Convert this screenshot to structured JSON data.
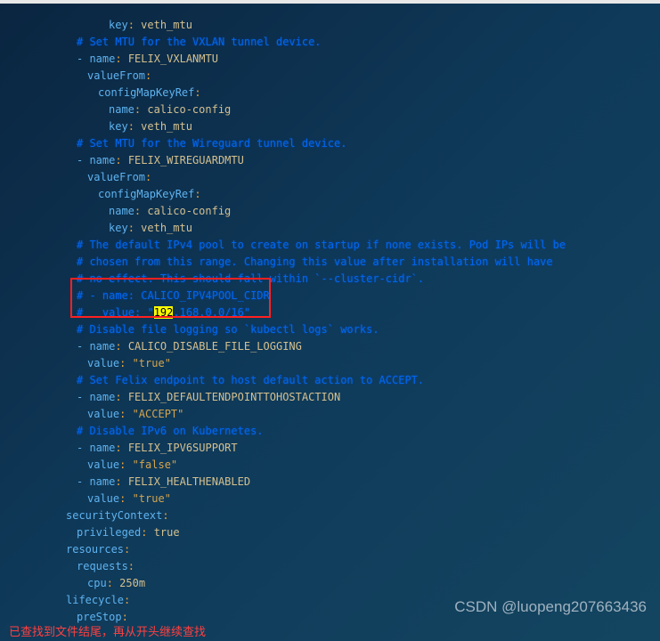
{
  "code": {
    "lines": [
      {
        "indent": "indent-4",
        "parts": [
          {
            "t": "key",
            "v": "key"
          },
          {
            "t": "colon",
            "v": ": "
          },
          {
            "t": "value-plain",
            "v": "veth_mtu"
          }
        ]
      },
      {
        "indent": "indent-1",
        "parts": [
          {
            "t": "comment",
            "v": "# Set MTU for the VXLAN tunnel device."
          }
        ]
      },
      {
        "indent": "indent-1",
        "parts": [
          {
            "t": "dash",
            "v": "- "
          },
          {
            "t": "key",
            "v": "name"
          },
          {
            "t": "colon",
            "v": ": "
          },
          {
            "t": "value-plain",
            "v": "FELIX_VXLANMTU"
          }
        ]
      },
      {
        "indent": "indent-2",
        "parts": [
          {
            "t": "key",
            "v": "valueFrom"
          },
          {
            "t": "colon",
            "v": ":"
          }
        ]
      },
      {
        "indent": "indent-3",
        "parts": [
          {
            "t": "key",
            "v": "configMapKeyRef"
          },
          {
            "t": "colon",
            "v": ":"
          }
        ]
      },
      {
        "indent": "indent-4",
        "parts": [
          {
            "t": "key",
            "v": "name"
          },
          {
            "t": "colon",
            "v": ": "
          },
          {
            "t": "value-plain",
            "v": "calico-config"
          }
        ]
      },
      {
        "indent": "indent-4",
        "parts": [
          {
            "t": "key",
            "v": "key"
          },
          {
            "t": "colon",
            "v": ": "
          },
          {
            "t": "value-plain",
            "v": "veth_mtu"
          }
        ]
      },
      {
        "indent": "indent-1",
        "parts": [
          {
            "t": "comment",
            "v": "# Set MTU for the Wireguard tunnel device."
          }
        ]
      },
      {
        "indent": "indent-1",
        "parts": [
          {
            "t": "dash",
            "v": "- "
          },
          {
            "t": "key",
            "v": "name"
          },
          {
            "t": "colon",
            "v": ": "
          },
          {
            "t": "value-plain",
            "v": "FELIX_WIREGUARDMTU"
          }
        ]
      },
      {
        "indent": "indent-2",
        "parts": [
          {
            "t": "key",
            "v": "valueFrom"
          },
          {
            "t": "colon",
            "v": ":"
          }
        ]
      },
      {
        "indent": "indent-3",
        "parts": [
          {
            "t": "key",
            "v": "configMapKeyRef"
          },
          {
            "t": "colon",
            "v": ":"
          }
        ]
      },
      {
        "indent": "indent-4",
        "parts": [
          {
            "t": "key",
            "v": "name"
          },
          {
            "t": "colon",
            "v": ": "
          },
          {
            "t": "value-plain",
            "v": "calico-config"
          }
        ]
      },
      {
        "indent": "indent-4",
        "parts": [
          {
            "t": "key",
            "v": "key"
          },
          {
            "t": "colon",
            "v": ": "
          },
          {
            "t": "value-plain",
            "v": "veth_mtu"
          }
        ]
      },
      {
        "indent": "indent-1",
        "parts": [
          {
            "t": "comment",
            "v": "# The default IPv4 pool to create on startup if none exists. Pod IPs will be"
          }
        ]
      },
      {
        "indent": "indent-1",
        "parts": [
          {
            "t": "comment",
            "v": "# chosen from this range. Changing this value after installation will have"
          }
        ]
      },
      {
        "indent": "indent-1",
        "parts": [
          {
            "t": "comment",
            "v": "# no effect. This should fall within `--cluster-cidr`."
          }
        ]
      },
      {
        "indent": "indent-1",
        "parts": [
          {
            "t": "comment",
            "v": "# - name: CALICO_IPV4POOL_CIDR"
          }
        ]
      },
      {
        "indent": "indent-1",
        "parts": [
          {
            "t": "comment",
            "v": "#   value: \""
          },
          {
            "t": "highlight-yellow",
            "v": "192"
          },
          {
            "t": "comment",
            "v": ".168.0.0/16\""
          }
        ]
      },
      {
        "indent": "indent-1",
        "parts": [
          {
            "t": "comment",
            "v": "# Disable file logging so `kubectl logs` works."
          }
        ]
      },
      {
        "indent": "indent-1",
        "parts": [
          {
            "t": "dash",
            "v": "- "
          },
          {
            "t": "key",
            "v": "name"
          },
          {
            "t": "colon",
            "v": ": "
          },
          {
            "t": "value-plain",
            "v": "CALICO_DISABLE_FILE_LOGGING"
          }
        ]
      },
      {
        "indent": "indent-2",
        "parts": [
          {
            "t": "key",
            "v": "value"
          },
          {
            "t": "colon",
            "v": ": "
          },
          {
            "t": "value-string",
            "v": "\"true\""
          }
        ]
      },
      {
        "indent": "indent-1",
        "parts": [
          {
            "t": "comment",
            "v": "# Set Felix endpoint to host default action to ACCEPT."
          }
        ]
      },
      {
        "indent": "indent-1",
        "parts": [
          {
            "t": "dash",
            "v": "- "
          },
          {
            "t": "key",
            "v": "name"
          },
          {
            "t": "colon",
            "v": ": "
          },
          {
            "t": "value-plain",
            "v": "FELIX_DEFAULTENDPOINTTOHOSTACTION"
          }
        ]
      },
      {
        "indent": "indent-2",
        "parts": [
          {
            "t": "key",
            "v": "value"
          },
          {
            "t": "colon",
            "v": ": "
          },
          {
            "t": "value-string",
            "v": "\"ACCEPT\""
          }
        ]
      },
      {
        "indent": "indent-1",
        "parts": [
          {
            "t": "comment",
            "v": "# Disable IPv6 on Kubernetes."
          }
        ]
      },
      {
        "indent": "indent-1",
        "parts": [
          {
            "t": "dash",
            "v": "- "
          },
          {
            "t": "key",
            "v": "name"
          },
          {
            "t": "colon",
            "v": ": "
          },
          {
            "t": "value-plain",
            "v": "FELIX_IPV6SUPPORT"
          }
        ]
      },
      {
        "indent": "indent-2",
        "parts": [
          {
            "t": "key",
            "v": "value"
          },
          {
            "t": "colon",
            "v": ": "
          },
          {
            "t": "value-string",
            "v": "\"false\""
          }
        ]
      },
      {
        "indent": "indent-1",
        "parts": [
          {
            "t": "dash",
            "v": "- "
          },
          {
            "t": "key",
            "v": "name"
          },
          {
            "t": "colon",
            "v": ": "
          },
          {
            "t": "value-plain",
            "v": "FELIX_HEALTHENABLED"
          }
        ]
      },
      {
        "indent": "indent-2",
        "parts": [
          {
            "t": "key",
            "v": "value"
          },
          {
            "t": "colon",
            "v": ": "
          },
          {
            "t": "value-string",
            "v": "\"true\""
          }
        ]
      },
      {
        "indent": "indent-sc",
        "parts": [
          {
            "t": "key",
            "v": "securityContext"
          },
          {
            "t": "colon",
            "v": ":"
          }
        ]
      },
      {
        "indent": "indent-sc2",
        "parts": [
          {
            "t": "key",
            "v": "privileged"
          },
          {
            "t": "colon",
            "v": ": "
          },
          {
            "t": "value-plain",
            "v": "true"
          }
        ]
      },
      {
        "indent": "indent-sc",
        "parts": [
          {
            "t": "key",
            "v": "resources"
          },
          {
            "t": "colon",
            "v": ":"
          }
        ]
      },
      {
        "indent": "indent-sc2",
        "parts": [
          {
            "t": "key",
            "v": "requests"
          },
          {
            "t": "colon",
            "v": ":"
          }
        ]
      },
      {
        "indent": "indent-2",
        "parts": [
          {
            "t": "key",
            "v": "cpu"
          },
          {
            "t": "colon",
            "v": ": "
          },
          {
            "t": "value-plain",
            "v": "250m"
          }
        ]
      },
      {
        "indent": "indent-sc",
        "parts": [
          {
            "t": "key",
            "v": "lifecycle"
          },
          {
            "t": "colon",
            "v": ":"
          }
        ]
      },
      {
        "indent": "indent-sc2",
        "parts": [
          {
            "t": "key",
            "v": "preStop"
          },
          {
            "t": "colon",
            "v": ":"
          }
        ]
      }
    ]
  },
  "status": "已查找到文件结尾，再从开头继续查找",
  "watermark": "CSDN @luopeng207663436"
}
